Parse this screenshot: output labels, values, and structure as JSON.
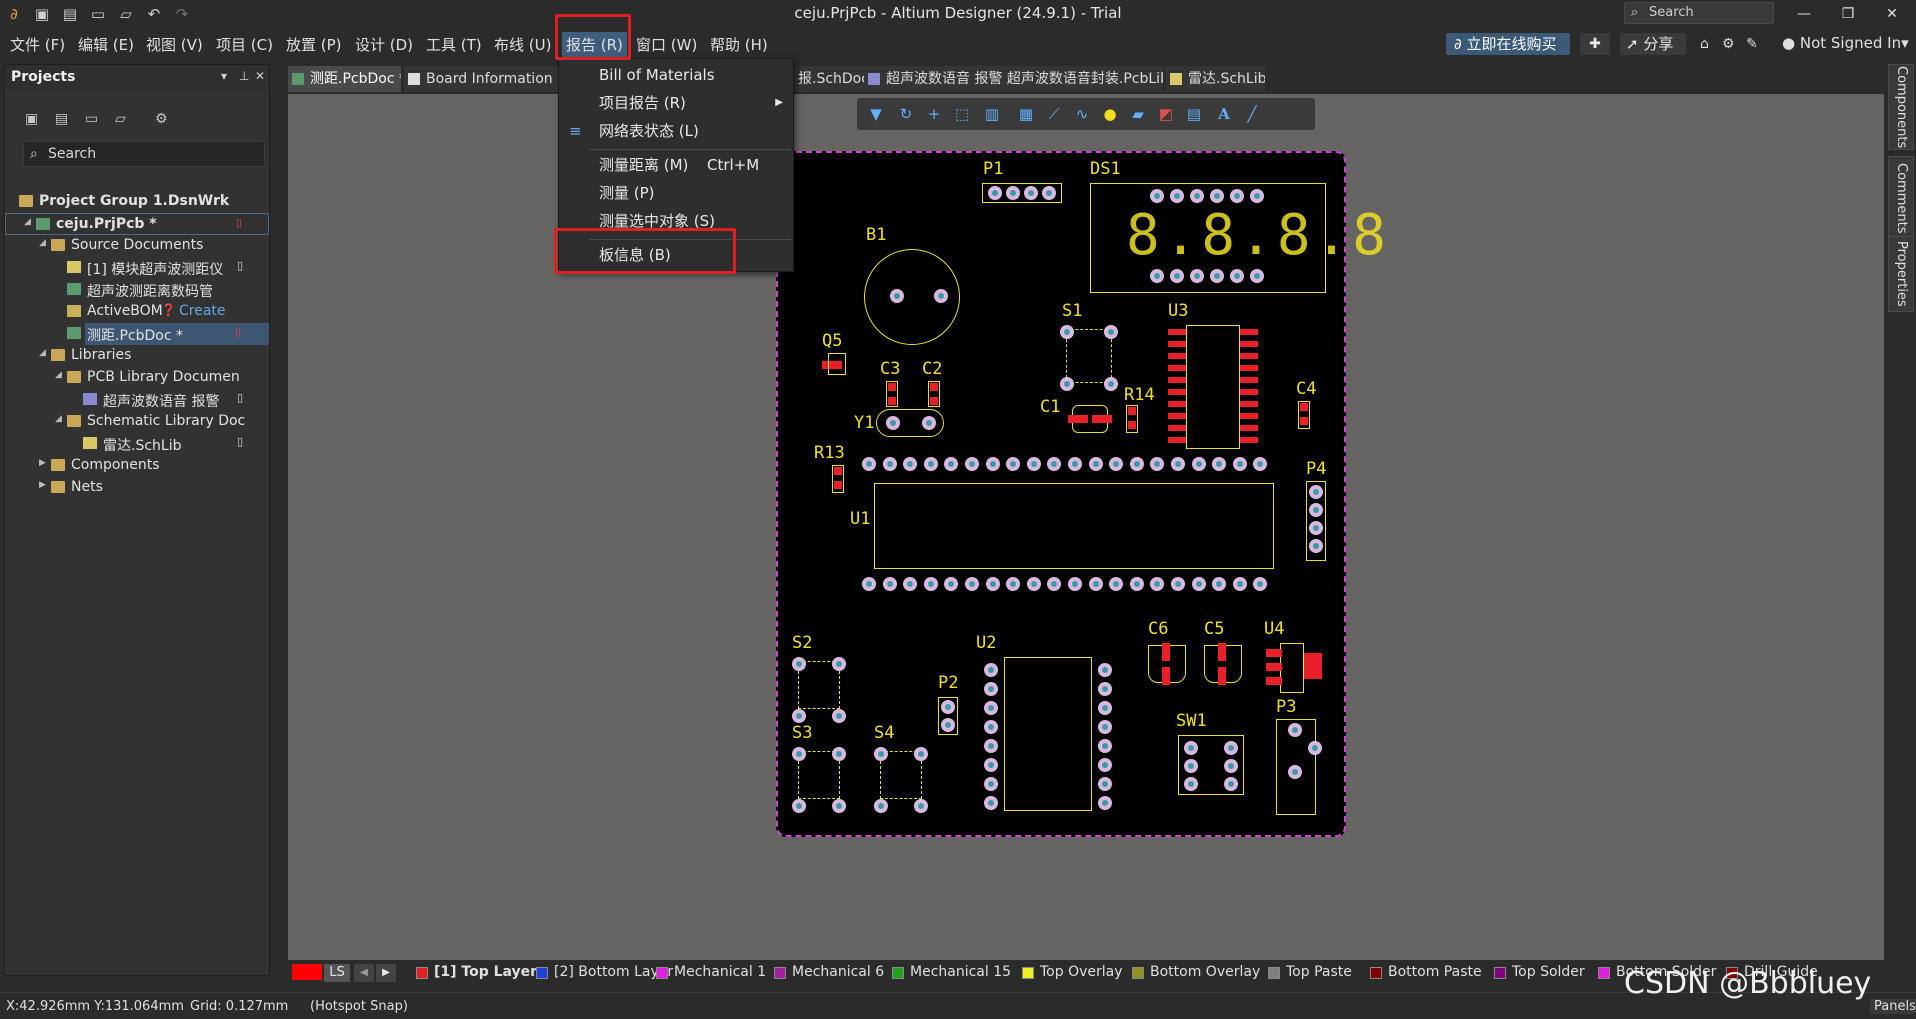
{
  "window": {
    "title": "ceju.PrjPcb - Altium Designer (24.9.1) - Trial",
    "search_label": "Search"
  },
  "menubar": {
    "items": [
      "文件 (F)",
      "编辑 (E)",
      "视图 (V)",
      "项目 (C)",
      "放置 (P)",
      "设计 (D)",
      "工具 (T)",
      "布线 (U)",
      "报告 (R)",
      "窗口 (W)",
      "帮助 (H)"
    ],
    "buy_label": "立即在线购买",
    "share_label": "分享",
    "user_label": "Not Signed In"
  },
  "projects": {
    "title": "Projects",
    "search_label": "Search",
    "tree": [
      {
        "label": "Project Group 1.DsnWrk"
      },
      {
        "label": "ceju.PrjPcb *"
      },
      {
        "label": "Source Documents"
      },
      {
        "label": "[1] 模块超声波测距仪"
      },
      {
        "label": "超声波测距离数码管"
      },
      {
        "label": "ActiveBOM",
        "extra": "Create"
      },
      {
        "label": "测距.PcbDoc *"
      },
      {
        "label": "Libraries"
      },
      {
        "label": "PCB Library Documen"
      },
      {
        "label": "超声波数语音 报警"
      },
      {
        "label": "Schematic Library Doc"
      },
      {
        "label": "雷达.SchLib"
      },
      {
        "label": "Components"
      },
      {
        "label": "Nets"
      }
    ]
  },
  "right_tabs": [
    "Components",
    "Comments",
    "Properties"
  ],
  "doc_tabs": [
    {
      "label": "测距.PcbDoc *"
    },
    {
      "label": "Board Information Re"
    },
    {
      "label": "报.SchDoc"
    },
    {
      "label": "超声波数语音 报警 超声波数语音封装.PcbLib"
    },
    {
      "label": "雷达.SchLib"
    }
  ],
  "report_menu": {
    "items": [
      {
        "label": "Bill of Materials",
        "shortcut": ""
      },
      {
        "label": "项目报告 (R)",
        "shortcut": ""
      },
      {
        "label": "网络表状态 (L)",
        "shortcut": ""
      },
      {
        "label": "测量距离 (M)",
        "shortcut": "Ctrl+M"
      },
      {
        "label": "测量 (P)",
        "shortcut": ""
      },
      {
        "label": "测量选中对象 (S)",
        "shortcut": ""
      },
      {
        "label": "板信息 (B)",
        "shortcut": ""
      }
    ]
  },
  "pcb": {
    "labels": [
      "P1",
      "DS1",
      "B1",
      "S1",
      "U3",
      "Q5",
      "C3",
      "C2",
      "R14",
      "C4",
      "C1",
      "Y1",
      "R13",
      "P4",
      "U1",
      "S2",
      "U2",
      "C6",
      "C5",
      "U4",
      "P2",
      "P3",
      "S3",
      "S4",
      "SW1"
    ],
    "seg_digits": "8.8.8.8"
  },
  "layers": {
    "ls_label": "LS",
    "items": [
      {
        "label": "[1] Top Layer",
        "color": "#e02020"
      },
      {
        "label": "[2] Bottom Layer",
        "color": "#2040e0"
      },
      {
        "label": "Mechanical 1",
        "color": "#e020e0"
      },
      {
        "label": "Mechanical 6",
        "color": "#a020a0"
      },
      {
        "label": "Mechanical 15",
        "color": "#20a020"
      },
      {
        "label": "Top Overlay",
        "color": "#f0f020"
      },
      {
        "label": "Bottom Overlay",
        "color": "#909020"
      },
      {
        "label": "Top Paste",
        "color": "#808080"
      },
      {
        "label": "Bottom Paste",
        "color": "#800000"
      },
      {
        "label": "Top Solder",
        "color": "#800080"
      },
      {
        "label": "Bottom Solder",
        "color": "#e020e0"
      },
      {
        "label": "Drill Guide",
        "color": "#800000"
      }
    ]
  },
  "status": {
    "coords": "X:42.926mm Y:131.064mm",
    "grid": "Grid: 0.127mm",
    "snap": "(Hotspot Snap)",
    "panels": "Panels"
  },
  "watermark": "CSDN @Bbbluey"
}
